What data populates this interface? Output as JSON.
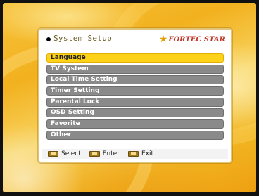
{
  "title": {
    "text": "System Setup",
    "brand": "FORTEC STAR",
    "brand_icon": "star-icon"
  },
  "menu": {
    "items": [
      {
        "label": "Language",
        "selected": true
      },
      {
        "label": "TV System",
        "selected": false
      },
      {
        "label": "Local Time Setting",
        "selected": false
      },
      {
        "label": "Timer Setting",
        "selected": false
      },
      {
        "label": "Parental Lock",
        "selected": false
      },
      {
        "label": "OSD Setting",
        "selected": false
      },
      {
        "label": "Favorite",
        "selected": false
      },
      {
        "label": "Other",
        "selected": false
      }
    ]
  },
  "help": {
    "select": "Select",
    "enter": "Enter",
    "exit": "Exit"
  },
  "colors": {
    "selected": "#ffd21a",
    "item": "#8a8a8a",
    "background": "#f2b11f",
    "brand": "#c0392b"
  }
}
